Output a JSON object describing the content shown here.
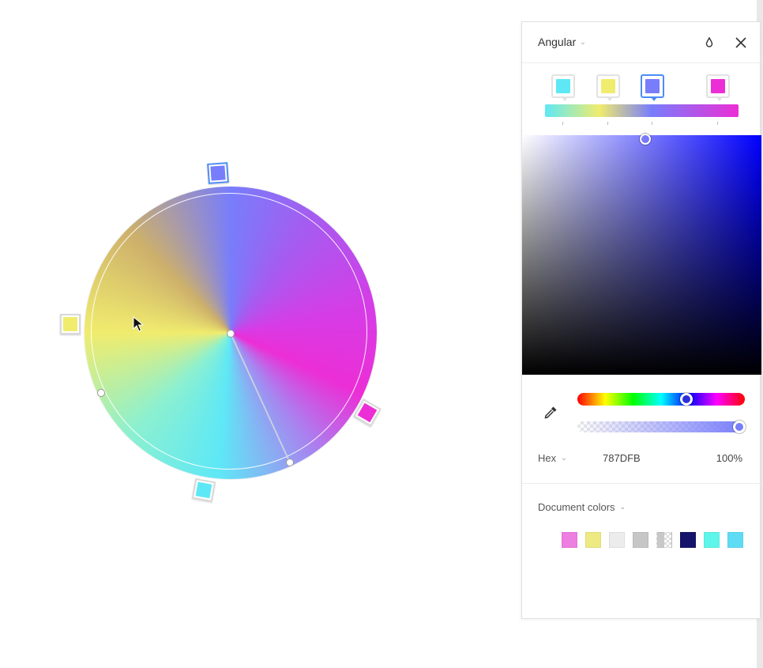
{
  "panel": {
    "gradient_type": "Angular",
    "icons": {
      "dropdown": "chevron-down-icon",
      "drop": "drop-icon",
      "close": "close-icon",
      "eyedropper": "eyedropper-icon"
    },
    "stops": [
      {
        "color": "#5ee8f6"
      },
      {
        "color": "#f0ec6e"
      },
      {
        "color": "#787dfb",
        "selected": true
      },
      {
        "color": "#ec2ed6"
      }
    ],
    "format_label": "Hex",
    "hex_value": "787DFB",
    "opacity": "100%",
    "document_colors_label": "Document colors",
    "document_colors": [
      "#ec7fe0",
      "#eeea82",
      "#ececec",
      "#c6c6c6",
      "checker",
      "#15136a",
      "#5ef6ea",
      "#5fdcf4"
    ]
  },
  "canvas": {
    "wheel_stops": [
      {
        "color": "#787dfb",
        "selected": true
      },
      {
        "color": "#f0ec6e"
      },
      {
        "color": "#ec2ed6"
      },
      {
        "color": "#5ee8f6"
      }
    ]
  }
}
